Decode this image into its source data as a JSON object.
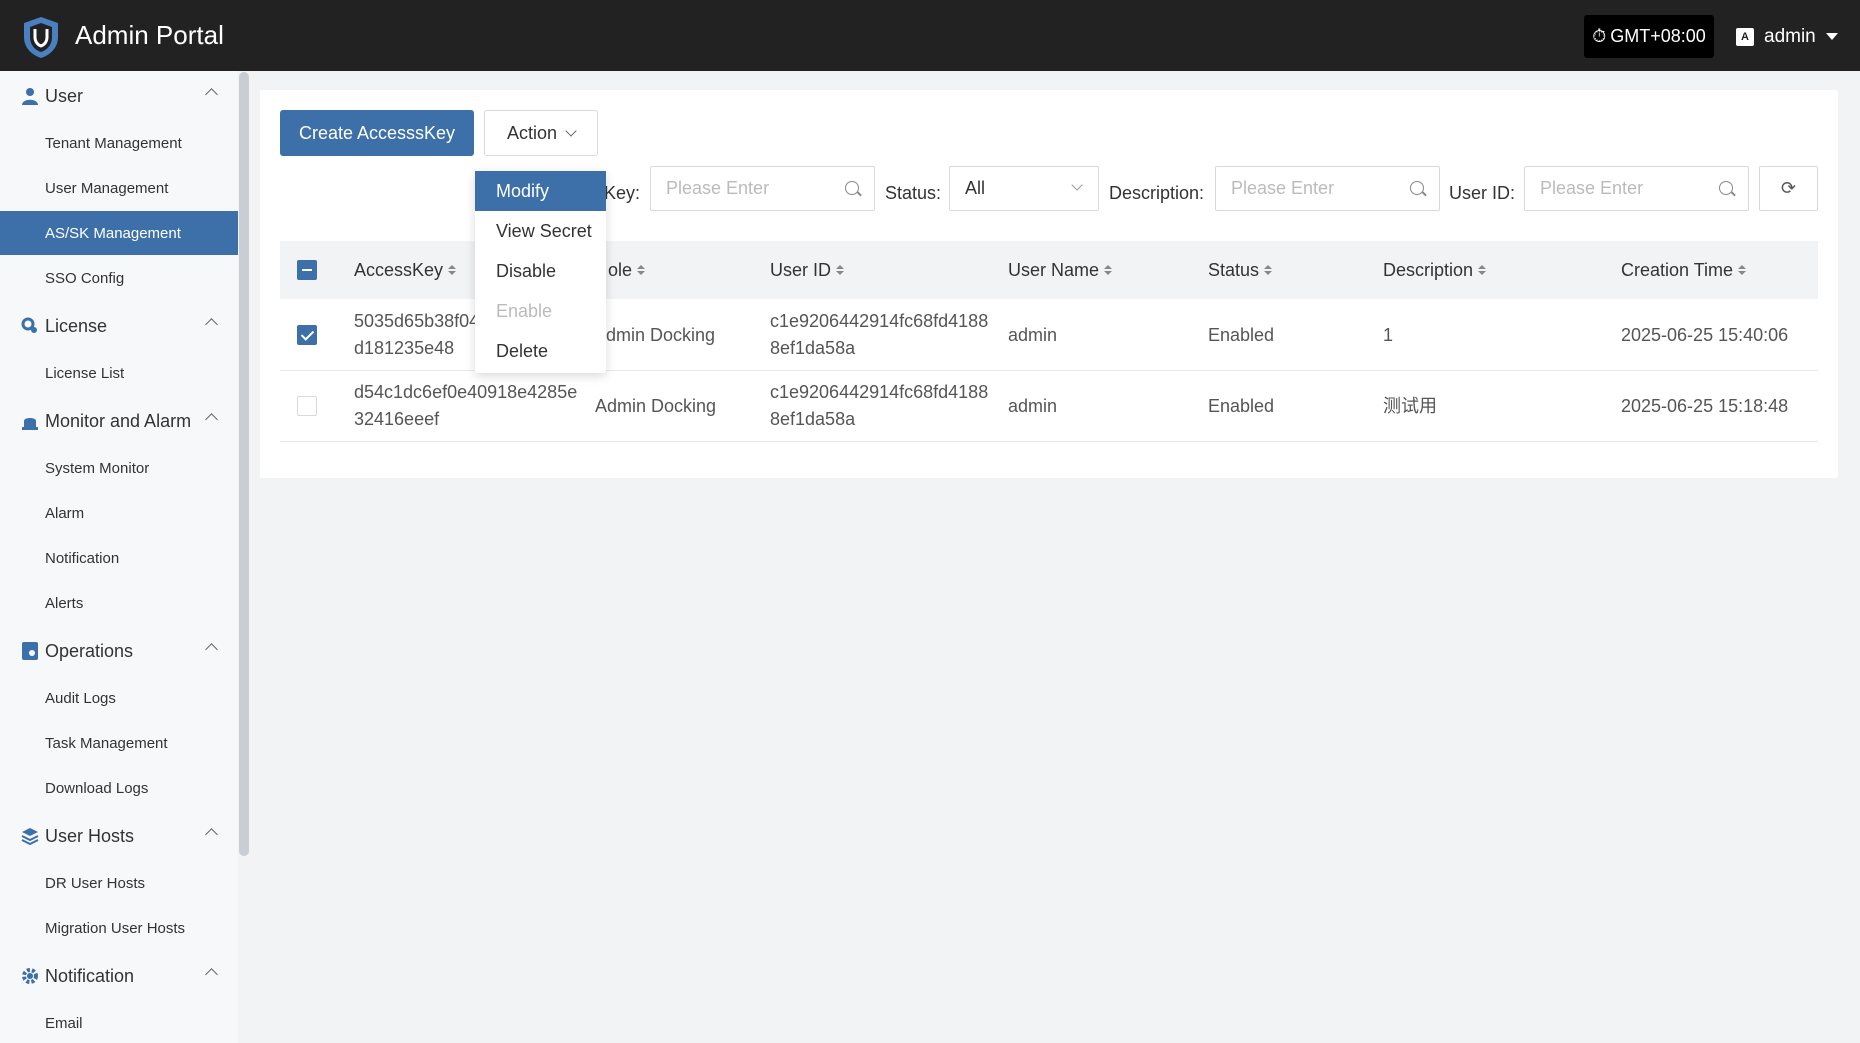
{
  "header": {
    "title": "Admin Portal",
    "timezone": "GMT+08:00",
    "user": "admin"
  },
  "sidebar": {
    "groups": [
      {
        "label": "User",
        "items": [
          "Tenant Management",
          "User Management",
          "AS/SK Management",
          "SSO Config"
        ]
      },
      {
        "label": "License",
        "items": [
          "License List"
        ]
      },
      {
        "label": "Monitor and Alarm",
        "items": [
          "System Monitor",
          "Alarm",
          "Notification",
          "Alerts"
        ]
      },
      {
        "label": "Operations",
        "items": [
          "Audit Logs",
          "Task Management",
          "Download Logs"
        ]
      },
      {
        "label": "User Hosts",
        "items": [
          "DR User Hosts",
          "Migration User Hosts"
        ]
      },
      {
        "label": "Notification",
        "items": [
          "Email"
        ]
      }
    ],
    "active_item": "AS/SK Management"
  },
  "toolbar": {
    "create_label": "Create AccesssKey",
    "action_label": "Action"
  },
  "filters": {
    "key_label": "Key:",
    "key_placeholder": "Please Enter",
    "status_label": "Status:",
    "status_value": "All",
    "description_label": "Description:",
    "description_placeholder": "Please Enter",
    "userid_label": "User ID:",
    "userid_placeholder": "Please Enter"
  },
  "table": {
    "columns": [
      "AccessKey",
      "Role",
      "User ID",
      "User Name",
      "Status",
      "Description",
      "Creation Time"
    ],
    "column_visible": [
      "AccessKey",
      "ole",
      "User ID",
      "User Name",
      "Status",
      "Description",
      "Creation Time"
    ],
    "rows": [
      {
        "checked": true,
        "accesskey_1": "5035d65b38f04",
        "accesskey_2": "d181235e48",
        "role": "dmin Docking",
        "userid_1": "c1e9206442914fc68fd4188",
        "userid_2": "8ef1da58a",
        "username": "admin",
        "status": "Enabled",
        "description": "1",
        "created": "2025-06-25 15:40:06"
      },
      {
        "checked": false,
        "accesskey_1": "d54c1dc6ef0e40918e4285e",
        "accesskey_2": "32416eeef",
        "role": "Admin Docking",
        "userid_1": "c1e9206442914fc68fd4188",
        "userid_2": "8ef1da58a",
        "username": "admin",
        "status": "Enabled",
        "description": "测试用",
        "created": "2025-06-25 15:18:48"
      }
    ]
  },
  "action_menu": {
    "items": [
      "Modify",
      "View Secret",
      "Disable",
      "Enable",
      "Delete"
    ],
    "active": "Modify",
    "disabled": [
      "Enable"
    ]
  },
  "colors": {
    "header_bg": "#222222",
    "accent": "#3d6fa8",
    "sidebar_bg": "#f7f8fa"
  }
}
